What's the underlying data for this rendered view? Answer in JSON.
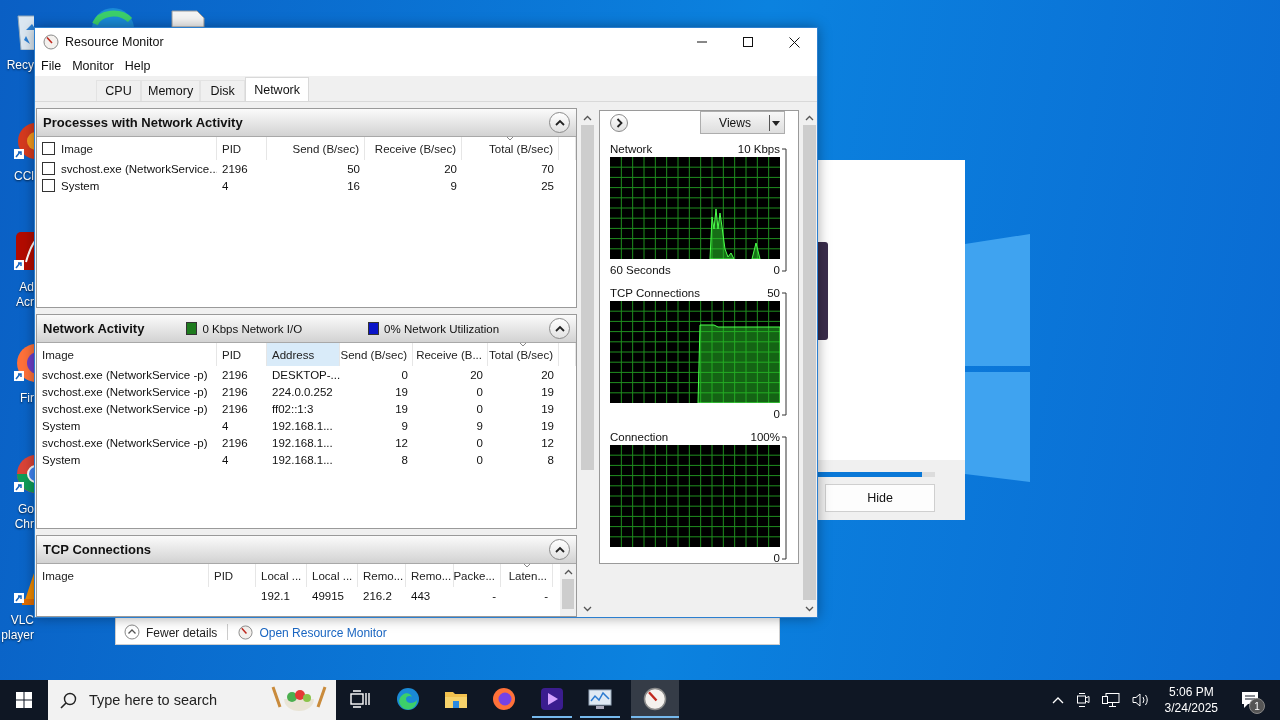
{
  "desktop": {
    "icons": [
      {
        "kind": "bin",
        "lines": [
          "Recy"
        ]
      },
      {
        "kind": "cleaner",
        "lines": [
          "CCl"
        ]
      },
      {
        "kind": "pdf",
        "lines": [
          "Ad",
          "Acr"
        ]
      },
      {
        "kind": "firefox",
        "lines": [
          "Fir"
        ]
      },
      {
        "kind": "chrome",
        "lines": [
          "Go",
          "Chr"
        ]
      },
      {
        "kind": "vlc",
        "lines": [
          "VLC",
          "player"
        ]
      }
    ]
  },
  "background_dialog": {
    "progress": {
      "level": 0.89
    },
    "hide_button": "Hide"
  },
  "details_bar": {
    "fewer_details": "Fewer details",
    "link": "Open Resource Monitor"
  },
  "window": {
    "title": "Resource Monitor",
    "menu": [
      "File",
      "Monitor",
      "Help"
    ],
    "tabs": [
      {
        "label": "CPU",
        "selected": false
      },
      {
        "label": "Memory",
        "selected": false
      },
      {
        "label": "Disk",
        "selected": false
      },
      {
        "label": "Network",
        "selected": true
      }
    ],
    "panels": [
      {
        "kind": "processes",
        "title": "Processes with Network Activity",
        "header_checked": false,
        "columns": [
          {
            "label": "Image",
            "sorted": false
          },
          {
            "label": "PID",
            "sorted": false
          },
          {
            "label": "Send (B/sec)",
            "sorted": false
          },
          {
            "label": "Receive (B/sec)",
            "sorted": false
          },
          {
            "label": "Total (B/sec)",
            "sorted": true
          }
        ],
        "rows": [
          {
            "checked": false,
            "cells": [
              "svchost.exe (NetworkService...",
              "2196",
              "50",
              "20",
              "70"
            ]
          },
          {
            "checked": false,
            "cells": [
              "System",
              "4",
              "16",
              "9",
              "25"
            ]
          }
        ]
      },
      {
        "kind": "activity",
        "title": "Network Activity",
        "legends": [
          {
            "label": "0 Kbps Network I/O",
            "color": "#1e7b1e"
          },
          {
            "label": "0% Network Utilization",
            "color": "#0a14c8"
          }
        ],
        "columns": [
          {
            "label": "Image",
            "sorted": false,
            "selected": false
          },
          {
            "label": "PID",
            "sorted": false,
            "selected": false
          },
          {
            "label": "Address",
            "sorted": false,
            "selected": true
          },
          {
            "label": "Send (B/sec)",
            "sorted": false,
            "selected": false
          },
          {
            "label": "Receive (B...",
            "sorted": false,
            "selected": false
          },
          {
            "label": "Total (B/sec)",
            "sorted": true,
            "selected": false
          }
        ],
        "rows": [
          {
            "cells": [
              "svchost.exe (NetworkService -p)",
              "2196",
              "DESKTOP-...",
              "0",
              "20",
              "20"
            ]
          },
          {
            "cells": [
              "svchost.exe (NetworkService -p)",
              "2196",
              "224.0.0.252",
              "19",
              "0",
              "19"
            ]
          },
          {
            "cells": [
              "svchost.exe (NetworkService -p)",
              "2196",
              "ff02::1:3",
              "19",
              "0",
              "19"
            ]
          },
          {
            "cells": [
              "System",
              "4",
              "192.168.1...",
              "9",
              "9",
              "19"
            ]
          },
          {
            "cells": [
              "svchost.exe (NetworkService -p)",
              "2196",
              "192.168.1...",
              "12",
              "0",
              "12"
            ]
          },
          {
            "cells": [
              "System",
              "4",
              "192.168.1...",
              "8",
              "0",
              "8"
            ]
          }
        ]
      },
      {
        "kind": "tcp",
        "title": "TCP Connections",
        "columns": [
          {
            "label": "Image",
            "sorted": false
          },
          {
            "label": "PID",
            "sorted": false
          },
          {
            "label": "Local ...",
            "sorted": false
          },
          {
            "label": "Local ...",
            "sorted": false
          },
          {
            "label": "Remo...",
            "sorted": false
          },
          {
            "label": "Remo...",
            "sorted": false
          },
          {
            "label": "Packe...",
            "sorted": false
          },
          {
            "label": "Laten...",
            "sorted": true
          }
        ],
        "rows": [
          {
            "cells": [
              "",
              "",
              "192.1",
              "49915",
              "216.2",
              "443",
              "-",
              "-"
            ]
          }
        ]
      }
    ],
    "right_pane": {
      "views_button": "Views",
      "graphs": [
        {
          "kind": "spikes",
          "title": "Network",
          "max": "10 Kbps",
          "footer": "60 Seconds",
          "min": "0"
        },
        {
          "kind": "step",
          "title": "TCP Connections",
          "max": "50",
          "min": "0"
        },
        {
          "kind": "flat",
          "title": "Connection",
          "max": "100%",
          "min": "0"
        }
      ]
    }
  },
  "taskbar": {
    "search_placeholder": "Type here to search",
    "apps": [
      {
        "kind": "taskview",
        "running": false,
        "active": false
      },
      {
        "kind": "edge",
        "running": false,
        "active": false
      },
      {
        "kind": "explorer",
        "running": false,
        "active": false
      },
      {
        "kind": "firefox",
        "running": false,
        "active": false
      },
      {
        "kind": "video",
        "running": true,
        "active": false
      },
      {
        "kind": "monitor",
        "running": true,
        "active": false
      },
      {
        "kind": "resmon",
        "running": true,
        "active": true
      }
    ],
    "time": "5:06 PM",
    "date": "3/24/2025",
    "notification_count": "1"
  }
}
